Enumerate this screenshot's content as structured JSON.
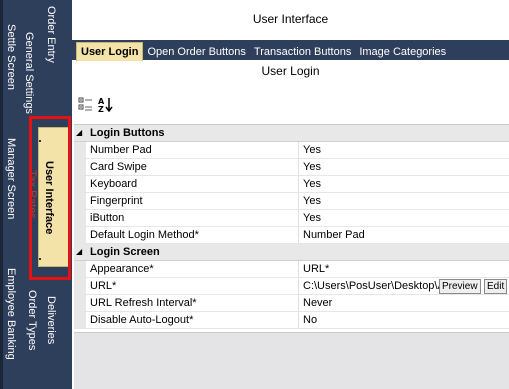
{
  "window": {
    "title": "User Interface"
  },
  "sidebar": {
    "tabs": [
      {
        "label": "Order Entry"
      },
      {
        "label": "General Settings"
      },
      {
        "label": "Settle Screen"
      },
      {
        "label": "User Interface"
      },
      {
        "label": "Tax Rates"
      },
      {
        "label": "Manager Screen"
      },
      {
        "label": "Deliveries"
      },
      {
        "label": "Order Types"
      },
      {
        "label": "Employee Banking"
      }
    ],
    "active_tab": "User Interface"
  },
  "tabs": [
    {
      "label": "User Login",
      "active": true
    },
    {
      "label": "Open Order Buttons",
      "active": false
    },
    {
      "label": "Transaction Buttons",
      "active": false
    },
    {
      "label": "Image Categories",
      "active": false
    }
  ],
  "panel": {
    "title": "User Login"
  },
  "toolbar": {
    "categorized_icon": "categorized-icon",
    "sort_icon": "sort-az-icon"
  },
  "property_grid": {
    "categories": [
      {
        "name": "Login Buttons",
        "properties": [
          {
            "name": "Number Pad",
            "value": "Yes"
          },
          {
            "name": "Card Swipe",
            "value": "Yes"
          },
          {
            "name": "Keyboard",
            "value": "Yes"
          },
          {
            "name": "Fingerprint",
            "value": "Yes"
          },
          {
            "name": "iButton",
            "value": "Yes"
          },
          {
            "name": "Default Login Method*",
            "value": "Number Pad"
          }
        ]
      },
      {
        "name": "Login Screen",
        "properties": [
          {
            "name": "Appearance*",
            "value": "URL*"
          },
          {
            "name": "URL*",
            "value": "C:\\Users\\PosUser\\Desktop\\A",
            "buttons": [
              "Preview",
              "Edit"
            ]
          },
          {
            "name": "URL Refresh Interval*",
            "value": "Never"
          },
          {
            "name": "Disable Auto-Logout*",
            "value": "No"
          }
        ]
      }
    ]
  },
  "colors": {
    "nav_bg": "#2e3f5c",
    "active_tab_bg": "#f3e3a9",
    "highlight_box": "#e81010"
  }
}
